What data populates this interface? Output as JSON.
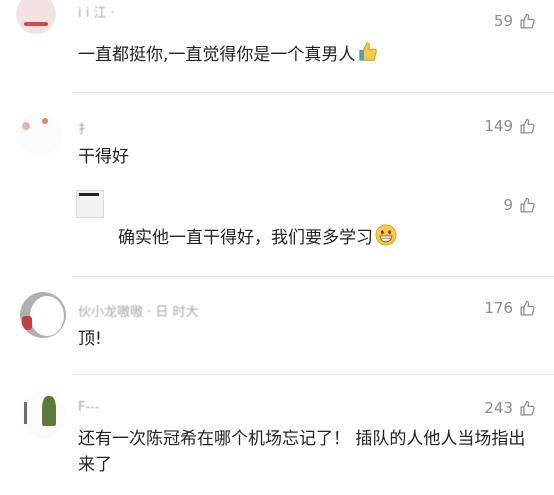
{
  "comments": [
    {
      "username": "i  i  江 ·",
      "likes": "59",
      "text": "一直都挺你,一直觉得你是一个真男人",
      "emoji": "thumbs-up-emoji"
    },
    {
      "username": "扌",
      "likes": "149",
      "text": "干得好"
    },
    {
      "username": "",
      "likes": "9",
      "text": "确实他一直干得好，我们要多学习",
      "emoji": "grinning-face-emoji"
    },
    {
      "username": "伙小龙嗷嗷 ·  日 时大",
      "likes": "176",
      "text": "顶!"
    },
    {
      "username": "F---",
      "likes": "243",
      "text": "还有一次陈冠希在哪个机场忘记了！ 插队的人他人当场指出来了"
    }
  ],
  "icons": {
    "like": "thumbs-up-outline-icon"
  },
  "colors": {
    "text": "#222222",
    "meta": "#8c8c8c",
    "divider": "#e6e6e6",
    "emoji_yellow": "#f7c948"
  }
}
